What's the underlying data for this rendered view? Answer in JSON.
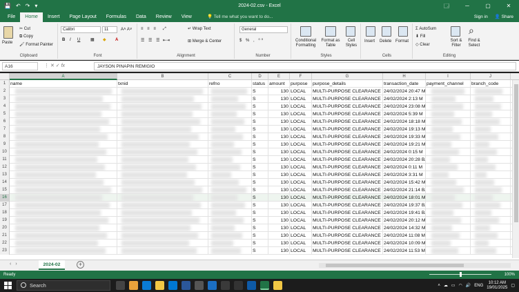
{
  "titlebar": {
    "title": "2024-02.csv  -  Excel",
    "quick": [
      "💾",
      "↶",
      "↷",
      "▾"
    ],
    "controls": [
      "🗔",
      "─",
      "▢",
      "✕"
    ]
  },
  "tabs": [
    {
      "label": "File"
    },
    {
      "label": "Home"
    },
    {
      "label": "Insert"
    },
    {
      "label": "Page Layout"
    },
    {
      "label": "Formulas"
    },
    {
      "label": "Data"
    },
    {
      "label": "Review"
    },
    {
      "label": "View"
    }
  ],
  "tell_me": "Tell me what you want to do...",
  "account": {
    "signin": "Sign in",
    "share": "Share"
  },
  "ribbon": {
    "clipboard": {
      "label": "Clipboard",
      "paste": "Paste",
      "cut": "Cut",
      "copy": "Copy",
      "painter": "Format Painter"
    },
    "font": {
      "label": "Font",
      "name": "Calibri",
      "size": "11"
    },
    "alignment": {
      "label": "Alignment",
      "wrap": "Wrap Text",
      "merge": "Merge & Center"
    },
    "number": {
      "label": "Number",
      "format": "General"
    },
    "styles": {
      "label": "Styles",
      "conditional": "Conditional Formatting",
      "format_table": "Format as Table",
      "cell_styles": "Cell Styles"
    },
    "cells": {
      "label": "Cells",
      "insert": "Insert",
      "delete": "Delete",
      "format": "Format"
    },
    "editing": {
      "label": "Editing",
      "autosum": "AutoSum",
      "fill": "Fill",
      "clear": "Clear",
      "sort": "Sort & Filter",
      "find": "Find & Select"
    }
  },
  "formula_bar": {
    "name_box": "A16",
    "formula": "JAYSON PINAPIN REMIGIO"
  },
  "columns": [
    "A",
    "B",
    "C",
    "D",
    "E",
    "F",
    "G",
    "H",
    "I",
    "J"
  ],
  "header_row": {
    "num": "1",
    "cells": [
      "name",
      "txnid",
      "refno",
      "status",
      "amount",
      "purpose",
      "purpose_details",
      "transaction_date",
      "payment_channel",
      "branch_code"
    ]
  },
  "rows": [
    {
      "num": "2",
      "status": "S",
      "amount": "130",
      "purpose": "LOCAL",
      "details": "MULTI-PURPOSE CLEARANCE",
      "date": "24/02/2024 20:47",
      "channel": "M"
    },
    {
      "num": "3",
      "status": "S",
      "amount": "130",
      "purpose": "LOCAL",
      "details": "MULTI-PURPOSE CLEARANCE",
      "date": "24/02/2024 2:13",
      "channel": "M"
    },
    {
      "num": "4",
      "status": "S",
      "amount": "130",
      "purpose": "LOCAL",
      "details": "MULTI-PURPOSE CLEARANCE",
      "date": "24/02/2024 23:08",
      "channel": "M"
    },
    {
      "num": "5",
      "status": "S",
      "amount": "130",
      "purpose": "LOCAL",
      "details": "MULTI-PURPOSE CLEARANCE",
      "date": "24/02/2024 5:39",
      "channel": "M"
    },
    {
      "num": "6",
      "status": "S",
      "amount": "130",
      "purpose": "LOCAL",
      "details": "MULTI-PURPOSE CLEARANCE",
      "date": "24/02/2024 18:18",
      "channel": "M"
    },
    {
      "num": "7",
      "status": "S",
      "amount": "130",
      "purpose": "LOCAL",
      "details": "MULTI-PURPOSE CLEARANCE",
      "date": "24/02/2024 19:13",
      "channel": "M"
    },
    {
      "num": "8",
      "status": "S",
      "amount": "130",
      "purpose": "LOCAL",
      "details": "MULTI-PURPOSE CLEARANCE",
      "date": "24/02/2024 19:33",
      "channel": "M"
    },
    {
      "num": "9",
      "status": "S",
      "amount": "130",
      "purpose": "LOCAL",
      "details": "MULTI-PURPOSE CLEARANCE",
      "date": "24/02/2024 19:21",
      "channel": "M"
    },
    {
      "num": "10",
      "status": "S",
      "amount": "130",
      "purpose": "LOCAL",
      "details": "MULTI-PURPOSE CLEARANCE",
      "date": "24/02/2024 0:15",
      "channel": "M"
    },
    {
      "num": "11",
      "status": "S",
      "amount": "130",
      "purpose": "LOCAL",
      "details": "MULTI-PURPOSE CLEARANCE",
      "date": "24/02/2024 20:28",
      "channel": "BA"
    },
    {
      "num": "12",
      "status": "S",
      "amount": "130",
      "purpose": "LOCAL",
      "details": "MULTI-PURPOSE CLEARANCE",
      "date": "24/02/2024 0:11",
      "channel": "M"
    },
    {
      "num": "13",
      "status": "S",
      "amount": "130",
      "purpose": "LOCAL",
      "details": "MULTI-PURPOSE CLEARANCE",
      "date": "24/02/2024 3:31",
      "channel": "M"
    },
    {
      "num": "14",
      "status": "S",
      "amount": "130",
      "purpose": "LOCAL",
      "details": "MULTI-PURPOSE CLEARANCE",
      "date": "24/02/2024 15:42",
      "channel": "M"
    },
    {
      "num": "15",
      "status": "S",
      "amount": "130",
      "purpose": "LOCAL",
      "details": "MULTI-PURPOSE CLEARANCE",
      "date": "24/02/2024 21:14",
      "channel": "BA"
    },
    {
      "num": "16",
      "status": "S",
      "amount": "130",
      "purpose": "LOCAL",
      "details": "MULTI-PURPOSE CLEARANCE",
      "date": "24/02/2024 18:01",
      "channel": "M"
    },
    {
      "num": "17",
      "status": "S",
      "amount": "130",
      "purpose": "LOCAL",
      "details": "MULTI-PURPOSE CLEARANCE",
      "date": "24/02/2024 19:37",
      "channel": "BA"
    },
    {
      "num": "18",
      "status": "S",
      "amount": "130",
      "purpose": "LOCAL",
      "details": "MULTI-PURPOSE CLEARANCE",
      "date": "24/02/2024 19:41",
      "channel": "BA"
    },
    {
      "num": "19",
      "status": "S",
      "amount": "130",
      "purpose": "LOCAL",
      "details": "MULTI-PURPOSE CLEARANCE",
      "date": "24/02/2024 20:12",
      "channel": "M"
    },
    {
      "num": "20",
      "status": "S",
      "amount": "130",
      "purpose": "LOCAL",
      "details": "MULTI-PURPOSE CLEARANCE",
      "date": "24/02/2024 14:32",
      "channel": "M"
    },
    {
      "num": "21",
      "status": "S",
      "amount": "130",
      "purpose": "LOCAL",
      "details": "MULTI-PURPOSE CLEARANCE",
      "date": "24/02/2024 11:08",
      "channel": "M"
    },
    {
      "num": "22",
      "status": "S",
      "amount": "130",
      "purpose": "LOCAL",
      "details": "MULTI-PURPOSE CLEARANCE",
      "date": "24/02/2024 10:09",
      "channel": "M"
    },
    {
      "num": "23",
      "status": "S",
      "amount": "130",
      "purpose": "LOCAL",
      "details": "MULTI-PURPOSE CLEARANCE",
      "date": "24/02/2024 11:53",
      "channel": "M"
    }
  ],
  "selected_row": "16",
  "sheet_tab": "2024-02",
  "status": {
    "ready": "Ready",
    "zoom": "100%"
  },
  "taskbar": {
    "search": "Search",
    "lang": "ENG",
    "time": "10:12 AM",
    "date": "19/01/2025"
  },
  "colors": {
    "accent": "#217346"
  }
}
